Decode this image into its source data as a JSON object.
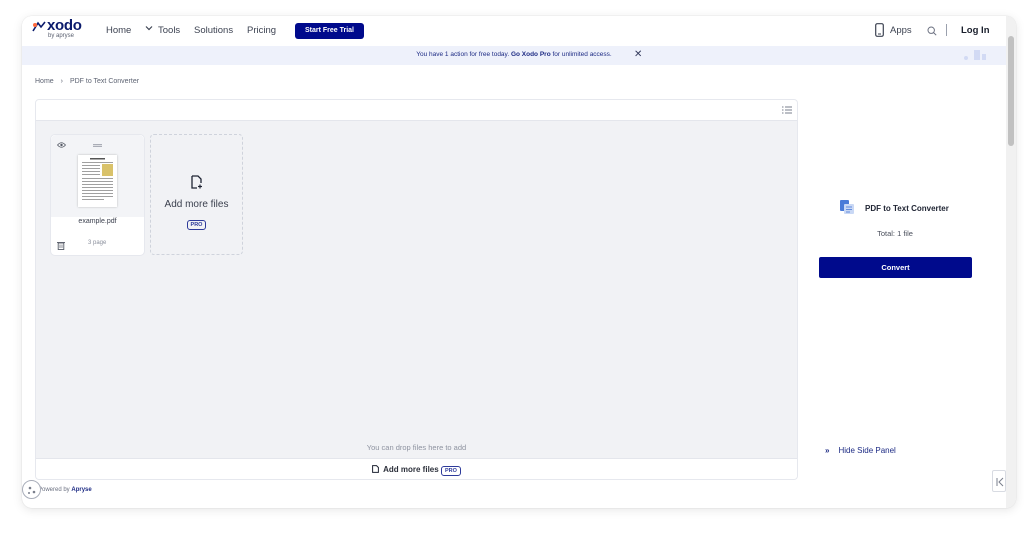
{
  "header": {
    "logo_text": "xodo",
    "logo_sub": "by apryse",
    "nav": {
      "home": "Home",
      "tools": "Tools",
      "solutions": "Solutions",
      "pricing": "Pricing"
    },
    "trial_label": "Start Free Trial",
    "apps_label": "Apps",
    "login_label": "Log In"
  },
  "banner": {
    "prefix": "You have 1 action for free today.",
    "strong": "Go Xodo Pro",
    "suffix": "for unlimited access.",
    "close": "✕"
  },
  "breadcrumb": {
    "home": "Home",
    "sep": "›",
    "current": "PDF to Text Converter"
  },
  "workspace": {
    "file": {
      "name": "example.pdf",
      "pages": "3 page"
    },
    "add_tile_label": "Add more files",
    "pro_label": "PRO",
    "drop_hint": "You can drop files here to add",
    "bottom_add_label": "Add more files"
  },
  "side_panel": {
    "title": "PDF to Text Converter",
    "total": "Total: 1 file",
    "convert_label": "Convert",
    "hide_chevron": "»",
    "hide_label": "Hide Side Panel"
  },
  "footer": {
    "powered_prefix": "Powered by",
    "powered_brand": "Apryse"
  },
  "colors": {
    "brand": "#000a8c",
    "banner_bg": "#eef1fb",
    "workspace_bg": "#f1f2f5"
  }
}
